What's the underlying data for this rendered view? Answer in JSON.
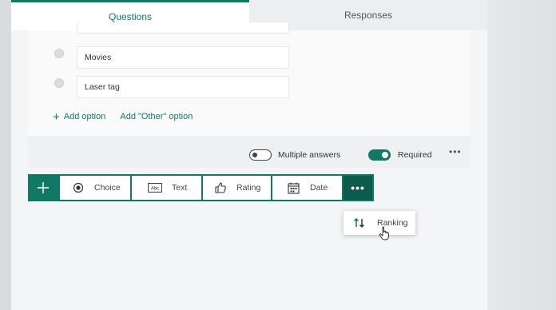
{
  "tabs": {
    "questions": "Questions",
    "responses": "Responses"
  },
  "options": [
    {
      "label": "Movies"
    },
    {
      "label": "Laser tag"
    }
  ],
  "add_option": "Add option",
  "add_other_option": "Add \"Other\" option",
  "settings": {
    "multiple_answers_label": "Multiple answers",
    "multiple_answers_on": false,
    "required_label": "Required",
    "required_on": true
  },
  "question_types": {
    "choice": "Choice",
    "text": "Text",
    "rating": "Rating",
    "date": "Date",
    "text_icon_caption": "Abc"
  },
  "more_menu": {
    "ranking": "Ranking"
  },
  "icons": {
    "add": "plus-icon",
    "choice": "radio-icon",
    "text": "text-field-icon",
    "rating": "thumbs-up-icon",
    "date": "calendar-icon",
    "more": "ellipsis-icon",
    "ranking": "sort-arrows-icon"
  },
  "colors": {
    "accent": "#117865",
    "accent_dark": "#0d5b4d"
  }
}
